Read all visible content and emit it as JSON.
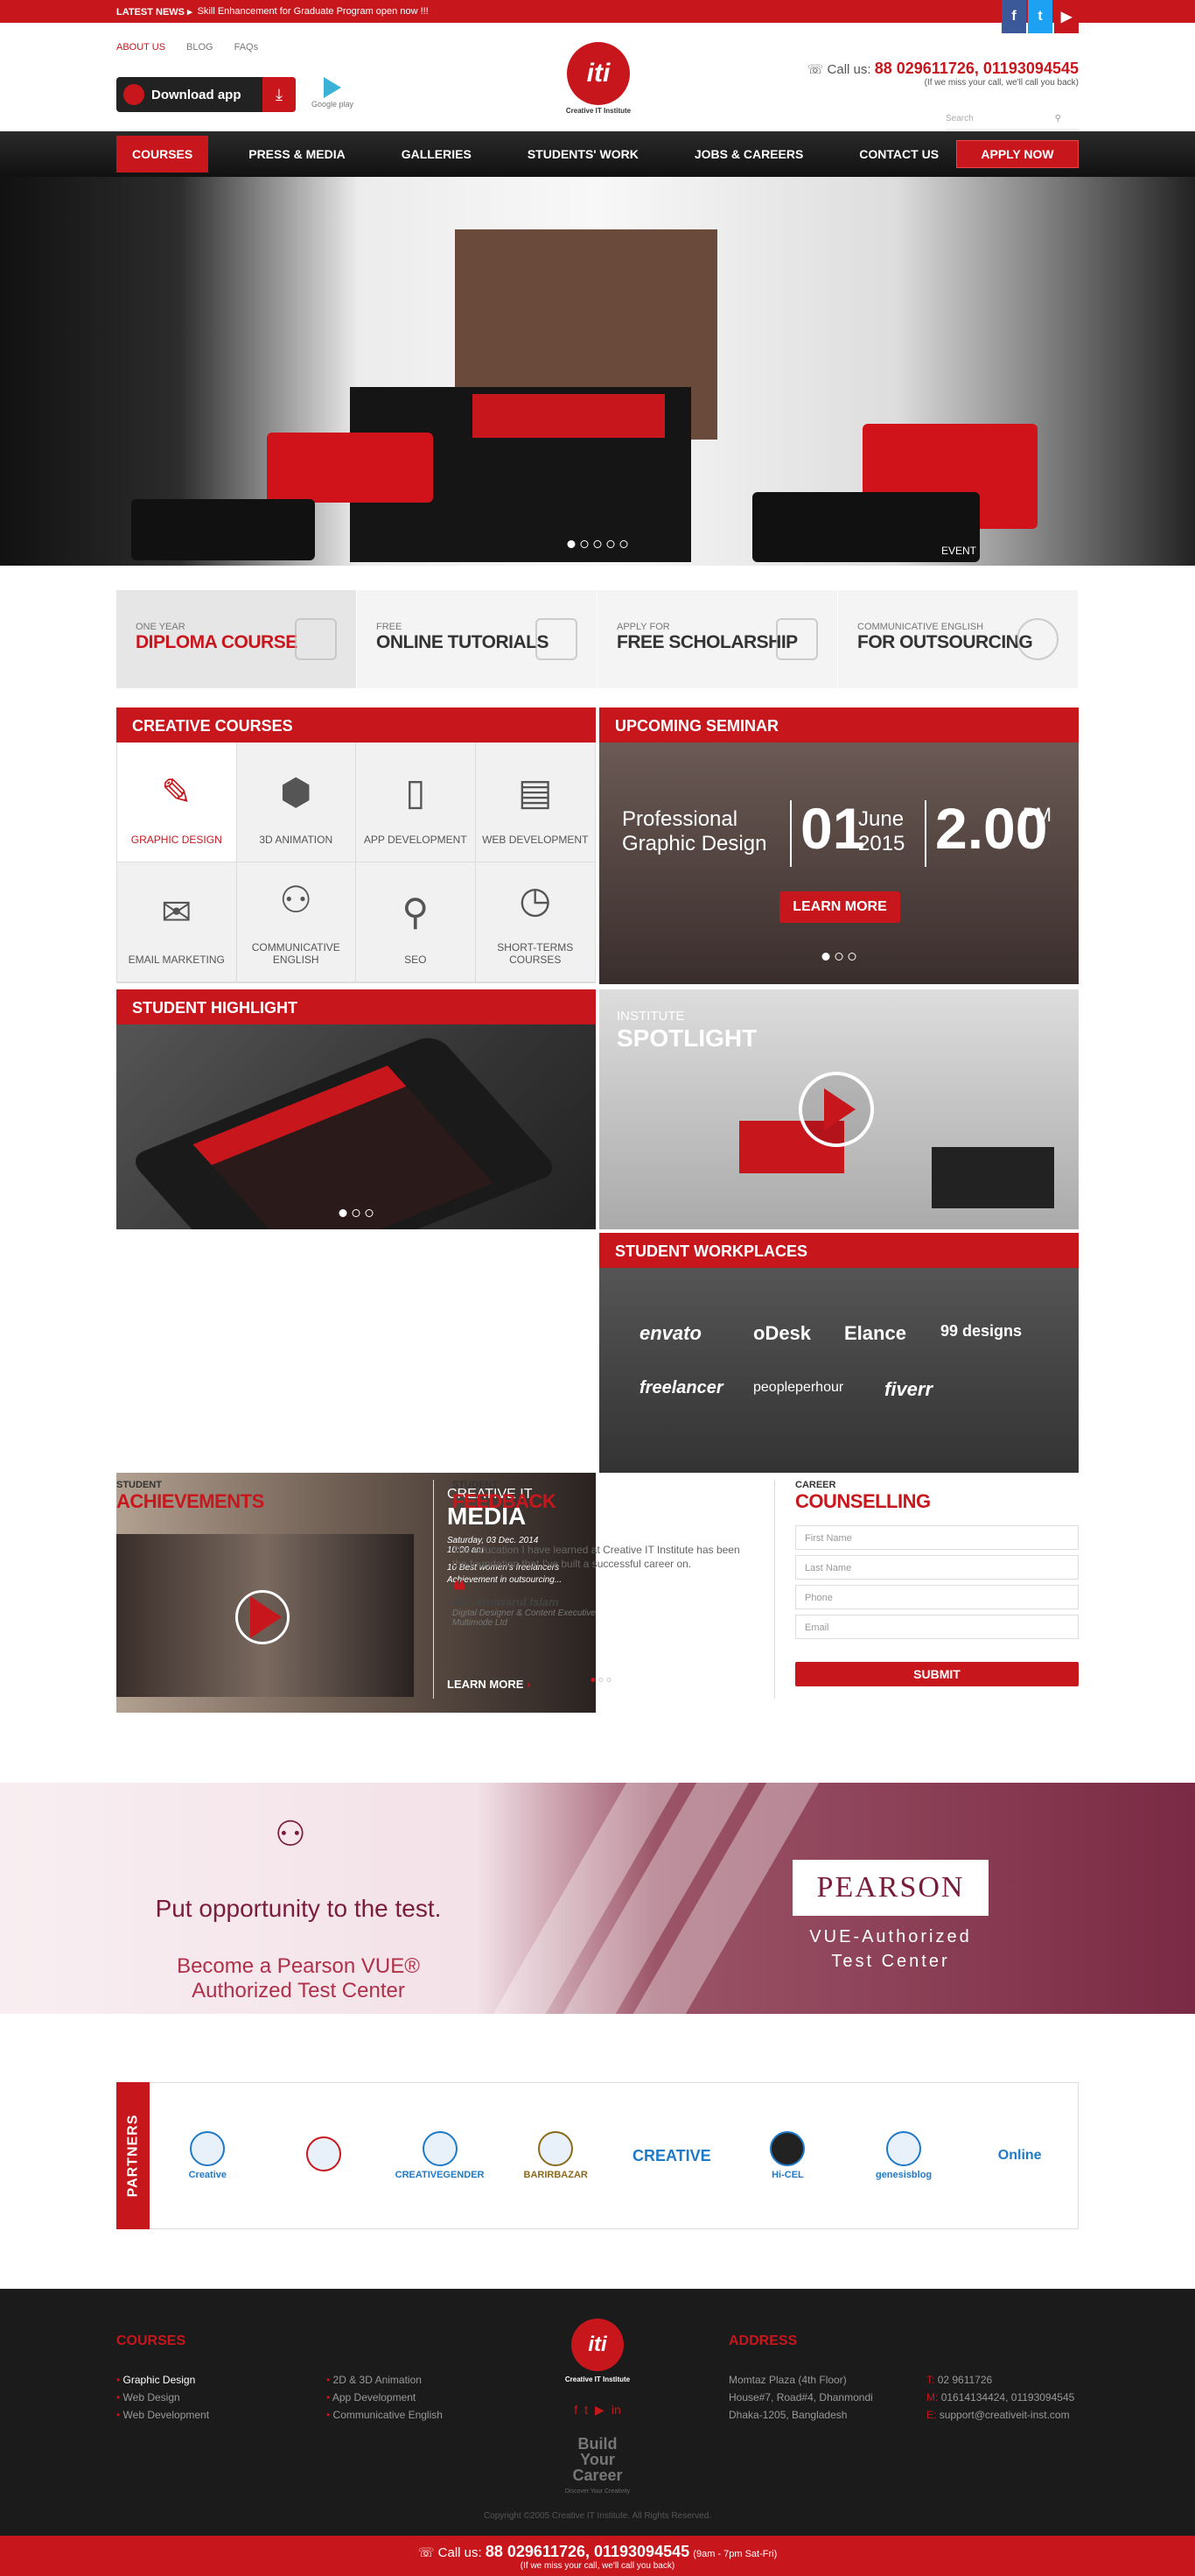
{
  "topbar": {
    "latest_label": "LATEST NEWS ▸",
    "news": "Skill Enhancement for Graduate Program open now !!!",
    "social": [
      "f",
      "t",
      "▶"
    ]
  },
  "header": {
    "links": [
      "ABOUT US",
      "BLOG",
      "FAQs"
    ],
    "download_app": "Download app",
    "google_play": "Google play",
    "logo_text": "Creative IT Institute",
    "logo_mark": "iti",
    "call_label": "Call us:",
    "call_numbers": "88 029611726, 01193094545",
    "call_note": "(If we miss your call, we'll call you back)",
    "search_placeholder": "Search"
  },
  "nav": {
    "items": [
      "COURSES",
      "PRESS & MEDIA",
      "GALLERIES",
      "STUDENTS' WORK",
      "JOBS & CAREERS",
      "CONTACT US"
    ],
    "apply": "APPLY NOW"
  },
  "hero": {
    "caption": "EVENT",
    "slides": 5,
    "active_slide": 1
  },
  "features": [
    {
      "small": "ONE YEAR",
      "big": "DIPLOMA COURSE",
      "icon": "certificate-icon"
    },
    {
      "small": "FREE",
      "big": "ONLINE TUTORIALS",
      "icon": "laptop-icon"
    },
    {
      "small": "APPLY FOR",
      "big": "FREE SCHOLARSHIP",
      "icon": "graduation-cap-icon"
    },
    {
      "small": "COMMUNICATIVE ENGLISH",
      "big": "FOR OUTSOURCING",
      "icon": "globe-icon"
    }
  ],
  "creative_courses": {
    "title": "CREATIVE COURSES",
    "items": [
      {
        "label": "GRAPHIC DESIGN",
        "icon": "pen-tool-icon"
      },
      {
        "label": "3D ANIMATION",
        "icon": "cube-icon"
      },
      {
        "label": "APP DEVELOPMENT",
        "icon": "smartphone-icon"
      },
      {
        "label": "WEB DEVELOPMENT",
        "icon": "browser-icon"
      },
      {
        "label": "EMAIL MARKETING",
        "icon": "envelope-icon"
      },
      {
        "label": "COMMUNICATIVE ENGLISH",
        "icon": "people-talk-icon"
      },
      {
        "label": "SEO",
        "icon": "magnifier-icon"
      },
      {
        "label": "SHORT-TERMS COURSES",
        "icon": "clock-icon"
      }
    ]
  },
  "seminar": {
    "title": "UPCOMING SEMINAR",
    "topic_l1": "Professional",
    "topic_l2": "Graphic Design",
    "day": "01",
    "month": "June",
    "year": "2015",
    "time": "2.00",
    "ampm": "PM",
    "cta": "LEARN MORE"
  },
  "student_highlight": {
    "title": "STUDENT HIGHLIGHT"
  },
  "spotlight": {
    "small": "INSTITUTE",
    "big": "SPOTLIGHT"
  },
  "media": {
    "small": "CREATIVE IT",
    "big": "MEDIA",
    "date": "Saturday, 03 Dec. 2014",
    "time": "10:00 am",
    "desc": "10 Best women's freelancers Achievement in outsourcing...",
    "cta": "LEARN MORE"
  },
  "workplaces": {
    "title": "STUDENT WORKPLACES",
    "brands": [
      "envato",
      "oDesk",
      "Elance",
      "99 designs",
      "freelancer",
      "peopleperhour",
      "fiverr"
    ]
  },
  "achievements": {
    "small": "STUDENT",
    "big": "ACHIEVEMENTS"
  },
  "feedback": {
    "small": "STUDENT",
    "big": "FEEDBACK",
    "text": "The education I have learned at Creative IT Institute has been the foundation that I've built a successful career on.",
    "name": "Md. Anowarul Islam",
    "role1": "Digital Designer & Content Executive",
    "role2": "Multimode Ltd"
  },
  "counselling": {
    "small": "CAREER",
    "big": "COUNSELLING",
    "fields": [
      "First Name",
      "Last Name",
      "Phone",
      "Email"
    ],
    "submit": "SUBMIT"
  },
  "pearson": {
    "line1": "Put opportunity to the test.",
    "line2": "Become a Pearson VUE®",
    "line3": "Authorized Test Center",
    "logo": "PEARSON",
    "vue1": "VUE-Authorized",
    "vue2": "Test Center"
  },
  "partners": {
    "title": "PARTNERS",
    "logos": [
      "Creative",
      "",
      "CREATIVEGENDER",
      "BARIRBAZAR",
      "CREATIVE",
      "Hi-CEL",
      "genesisblog",
      "Online"
    ]
  },
  "footer": {
    "courses_title": "COURSES",
    "col1": [
      "Graphic Design",
      "Web Design",
      "Web Development"
    ],
    "col2": [
      "2D & 3D Animation",
      "App Development",
      "Communicative English"
    ],
    "logo_text": "Creative IT Institute",
    "tagline": "Build Your Career",
    "tagline_sub": "Discover Your Creativity",
    "address_title": "ADDRESS",
    "address": [
      "Momtaz Plaza (4th Floor)",
      "House#7, Road#4, Dhanmondi",
      "Dhaka-1205, Bangladesh"
    ],
    "contact": [
      {
        "k": "T:",
        "v": "02 9611726"
      },
      {
        "k": "M:",
        "v": "01614134424, 01193094545"
      },
      {
        "k": "E:",
        "v": "support@creativeit-inst.com"
      }
    ],
    "copyright": "Copyright ©2005 Creative IT Institute. All Rights Reserved.",
    "call_label": "Call us:",
    "call_numbers": "88 029611726, 01193094545",
    "call_hours": "(9am - 7pm Sat-Fri)",
    "call_note": "(If we miss your call, we'll call you back)"
  }
}
